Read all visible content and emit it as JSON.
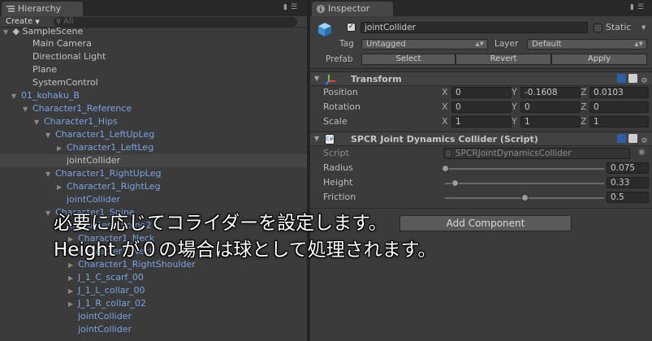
{
  "hierarchy": {
    "tab_label": "Hierarchy",
    "create_label": "Create",
    "search_placeholder": "All",
    "scene_name": "SampleScene",
    "rows": [
      {
        "label": "Main Camera",
        "indent": 1,
        "arrow": "",
        "color": "plain"
      },
      {
        "label": "Directional Light",
        "indent": 1,
        "arrow": "",
        "color": "plain"
      },
      {
        "label": "Plane",
        "indent": 1,
        "arrow": "",
        "color": "plain"
      },
      {
        "label": "SystemControl",
        "indent": 1,
        "arrow": "",
        "color": "plain"
      },
      {
        "label": "01_kohaku_B",
        "indent": 0,
        "arrow": "down",
        "color": "blue"
      },
      {
        "label": "Character1_Reference",
        "indent": 1,
        "arrow": "down",
        "color": "blue"
      },
      {
        "label": "Character1_Hips",
        "indent": 2,
        "arrow": "down",
        "color": "blue"
      },
      {
        "label": "Character1_LeftUpLeg",
        "indent": 3,
        "arrow": "down",
        "color": "blue"
      },
      {
        "label": "Character1_LeftLeg",
        "indent": 4,
        "arrow": "right",
        "color": "blue"
      },
      {
        "label": "jointCollider",
        "indent": 4,
        "arrow": "",
        "color": "plain",
        "selected": true
      },
      {
        "label": "Character1_RightUpLeg",
        "indent": 3,
        "arrow": "down",
        "color": "blue"
      },
      {
        "label": "Character1_RightLeg",
        "indent": 4,
        "arrow": "right",
        "color": "blue"
      },
      {
        "label": "jointCollider",
        "indent": 4,
        "arrow": "",
        "color": "blue"
      },
      {
        "label": "Character1_Spine",
        "indent": 3,
        "arrow": "down",
        "color": "blue"
      },
      {
        "label": "Character1_Spine2",
        "indent": 4,
        "arrow": "down",
        "color": "blue"
      },
      {
        "label": "Character1_Neck",
        "indent": 5,
        "arrow": "right",
        "color": "blue"
      },
      {
        "label": "Character1_Neck",
        "indent": 5,
        "arrow": "right",
        "color": "blue"
      },
      {
        "label": "Character1_RightShoulder",
        "indent": 5,
        "arrow": "right",
        "color": "blue"
      },
      {
        "label": "J_1_C_scarf_00",
        "indent": 5,
        "arrow": "right",
        "color": "blue"
      },
      {
        "label": "J_1_L_collar_00",
        "indent": 5,
        "arrow": "right",
        "color": "blue"
      },
      {
        "label": "J_1_R_collar_02",
        "indent": 5,
        "arrow": "right",
        "color": "blue"
      },
      {
        "label": "jointCollider",
        "indent": 5,
        "arrow": "",
        "color": "blue"
      },
      {
        "label": "jointCollider",
        "indent": 5,
        "arrow": "",
        "color": "blue"
      }
    ]
  },
  "inspector": {
    "tab_label": "Inspector",
    "object_name": "jointCollider",
    "static_label": "Static",
    "tag_label": "Tag",
    "tag_value": "Untagged",
    "layer_label": "Layer",
    "layer_value": "Default",
    "prefab_label": "Prefab",
    "select_label": "Select",
    "revert_label": "Revert",
    "apply_label": "Apply",
    "transform": {
      "title": "Transform",
      "position_label": "Position",
      "rotation_label": "Rotation",
      "scale_label": "Scale",
      "axis_x": "X",
      "axis_y": "Y",
      "axis_z": "Z",
      "position": [
        "0",
        "-0.1608",
        "0.0103"
      ],
      "rotation": [
        "0",
        "0",
        "0"
      ],
      "scale": [
        "1",
        "1",
        "1"
      ]
    },
    "collider": {
      "title": "SPCR Joint Dynamics Collider (Script)",
      "script_label": "Script",
      "script_value": "SPCRJointDynamicsCollider",
      "radius_label": "Radius",
      "radius_value": "0.075",
      "radius_level": 0.0,
      "height_label": "Height",
      "height_value": "0.33",
      "height_level": 0.06,
      "friction_label": "Friction",
      "friction_value": "0.5",
      "friction_level": 0.5
    },
    "add_component_label": "Add Component"
  },
  "subtitles": {
    "line1": "必要に応じてコライダーを設定します。",
    "line2": "Height が０の場合は球として処理されます。"
  },
  "colors": {
    "hierarchy_blue": "#7aa4e6",
    "selection_gray": "#464646"
  }
}
